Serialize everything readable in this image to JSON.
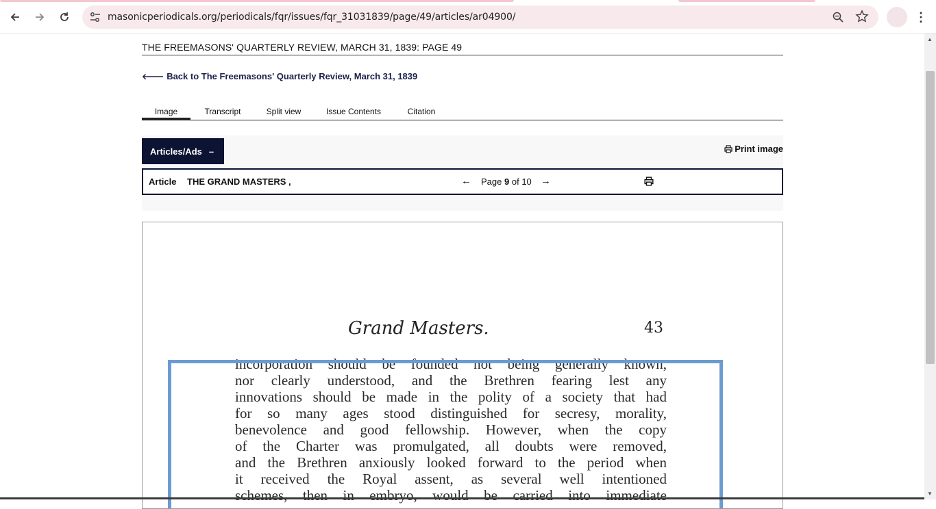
{
  "browser": {
    "url": "masonicperiodicals.org/periodicals/fqr/issues/fqr_31031839/page/49/articles/ar04900/",
    "icons": {
      "back": "arrow-left-icon",
      "forward": "arrow-right-icon",
      "reload": "reload-icon",
      "site_info": "tune-icon",
      "zoom": "magnifier-icon",
      "bookmark": "star-icon",
      "menu": "kebab-menu-icon"
    },
    "accent_color": "#f4c7cf",
    "omnibox_color": "#f7e9ec"
  },
  "page": {
    "heading": "THE FREEMASONS' QUARTERLY REVIEW, MARCH 31, 1839: PAGE 49",
    "back_link": "Back to The Freemasons' Quarterly Review, March 31, 1839",
    "tabs": [
      {
        "label": "Image",
        "active": true
      },
      {
        "label": "Transcript",
        "active": false
      },
      {
        "label": "Split view",
        "active": false
      },
      {
        "label": "Issue Contents",
        "active": false
      },
      {
        "label": "Citation",
        "active": false
      }
    ],
    "articles_button": "Articles/Ads",
    "articles_button_symbol": "–",
    "print_image": "Print image",
    "article_bar": {
      "label": "Article",
      "title": "THE GRAND MASTERS ,",
      "pager_prefix": "Page",
      "current_page": "9",
      "pager_suffix": "of 10",
      "prev_arrow": "←",
      "next_arrow": "→"
    },
    "brand_color": "#0c1333"
  },
  "scan": {
    "header": "Grand Masters.",
    "page_number": "43",
    "lines": [
      "incorporation should be founded not being generally known,",
      "nor clearly understood, and the Brethren fearing lest any",
      "innovations should be made in the polity of a society that had",
      "for so many ages stood distinguished for secresy, morality,",
      "benevolence and good fellowship. However, when the copy",
      "of the Charter was promulgated, all doubts were removed,",
      "and the Brethren anxiously looked forward to the period when",
      "it received the Royal assent, as several well intentioned",
      "schemes, then in embryo, would be carried into immediate"
    ],
    "highlight_color": "#6c9bd2"
  }
}
